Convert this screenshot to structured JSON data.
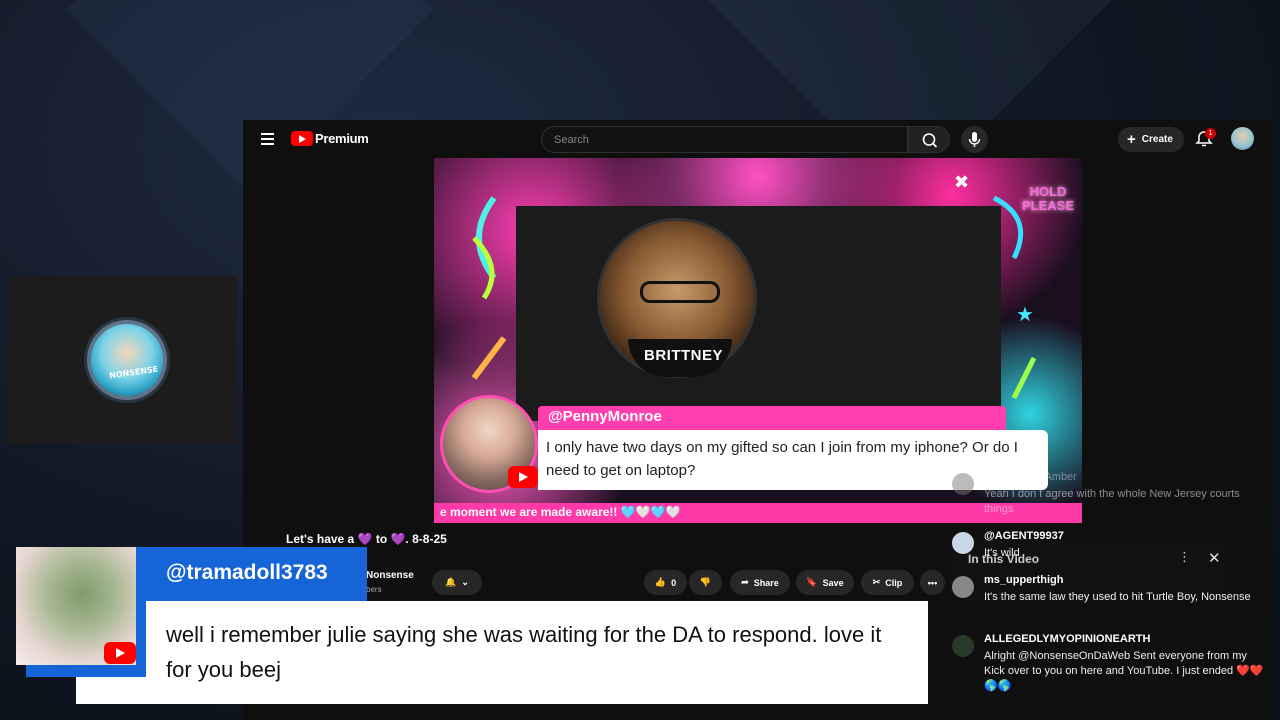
{
  "topbar": {
    "brand": "Premium",
    "search_placeholder": "Search",
    "create_label": "Create",
    "notification_count": "1"
  },
  "video": {
    "hold_text": "HOLD\nPLEASE",
    "bear_shirt": "BRITTNEY",
    "comment_handle": "@PennyMonroe",
    "comment_text": "I only have two days on my gifted so can I join from my iphone? Or do I need to get on laptop?",
    "ticker_text": "e moment we are made aware!! 🩵🤍🩵🤍"
  },
  "meta": {
    "title": "Let's have a 💜 to 💜. 8-8-25",
    "channel": "Nonsense",
    "subscribers": "bers",
    "like_count": "0",
    "share_label": "Share",
    "save_label": "Save",
    "clip_label": "Clip"
  },
  "chat": {
    "in_this_video": "In this Video",
    "messages": [
      {
        "author": "lAmber",
        "text": "Yeah I don t agree with the whole New Jersey courts things"
      },
      {
        "author": "@AGENT99937",
        "text": "It's wild"
      },
      {
        "author": "ms_upperthigh",
        "text": "It's the same law they used to hit Turtle Boy, Nonsense"
      },
      {
        "author": "ALLEGEDLYMYOPINIONEARTH",
        "text": "Alright @NonsenseOnDaWeb Sent everyone from my Kick over to you on here and YouTube. I just ended ❤️❤️🌎🌎"
      }
    ]
  },
  "overlay": {
    "handle": "@tramadoll3783",
    "message": "well i remember julie saying she was waiting for the DA to respond. love it for you beej"
  },
  "colors": {
    "overlay_blue": "#1565d8",
    "youtube_red": "#ff0000",
    "stream_pink": "#ff3fae"
  }
}
